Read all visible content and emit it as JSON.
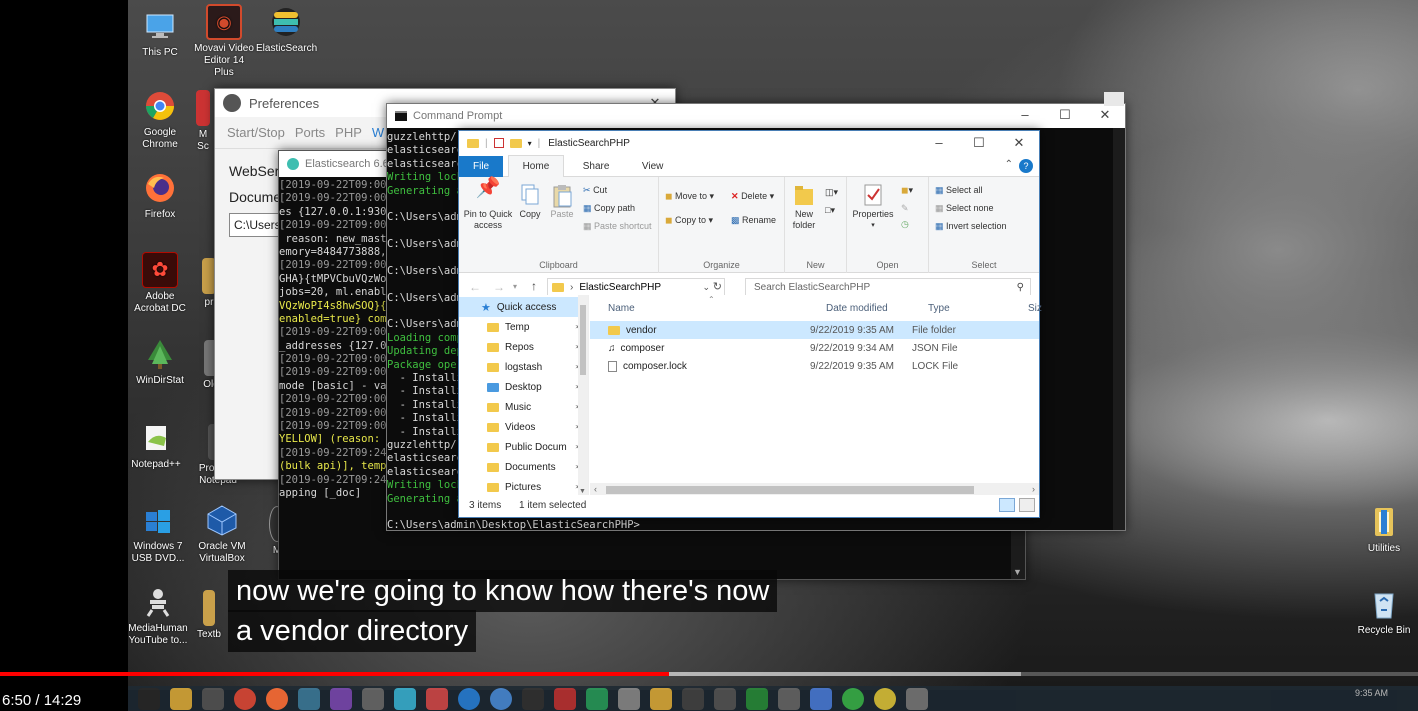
{
  "desktop_icons": [
    {
      "label": "This PC",
      "icon": "monitor-icon",
      "color": "#4aa3e8"
    },
    {
      "label": "Movavi Video Editor 14 Plus",
      "icon": "movavi-icon",
      "color": "#d24a2c"
    },
    {
      "label": "ElasticSearch",
      "icon": "elasticsearch-icon",
      "color": "#3ebeb0"
    },
    {
      "label": "Google Chrome",
      "icon": "chrome-icon",
      "color": "#dd4b39"
    },
    {
      "label": "Firefox",
      "icon": "firefox-icon",
      "color": "#ff7139"
    },
    {
      "label": "Adobe Acrobat DC",
      "icon": "acrobat-icon",
      "color": "#b30b00"
    },
    {
      "label": "WinDirStat",
      "icon": "windirstat-icon",
      "color": "#3a8a3a"
    },
    {
      "label": "Notepad++",
      "icon": "notepadpp-icon",
      "color": "#8bc34a"
    },
    {
      "label": "Windows 7 USB DVD...",
      "icon": "windows-usb-icon",
      "color": "#2a7fd4"
    },
    {
      "label": "Oracle VM VirtualBox",
      "icon": "virtualbox-icon",
      "color": "#1e5aa8"
    },
    {
      "label": "MediaHuman YouTube to...",
      "icon": "mediahuman-icon",
      "color": "#cccccc"
    },
    {
      "label": "Utilities",
      "icon": "utilities-icon",
      "color": "#e6c35a"
    },
    {
      "label": "Recycle Bin",
      "icon": "recycle-bin-icon",
      "color": "#9ec7e6"
    }
  ],
  "desktop_partial_labels": {
    "ms": "M",
    "sc": "Sc",
    "pr": "pr",
    "old": "Old",
    "program": "Program",
    "notepad": "Notepad",
    "textb": "Textb",
    "m": "M"
  },
  "preferences": {
    "title": "Preferences",
    "tabs": [
      "Start/Stop",
      "Ports",
      "PHP",
      "W"
    ],
    "label1": "WebServ",
    "label2": "Documen",
    "path_value": "C:\\Users\\a"
  },
  "elasticsearch_window": {
    "title": "Elasticsearch 6.6",
    "log": [
      {
        "t": "[2019-09-22T09:00",
        "c": "#9a9a9a"
      },
      {
        "t": "[2019-09-22T09:00",
        "c": "#9a9a9a"
      },
      {
        "t": "es {127.0.0.1:930",
        "c": "#d8d8d8"
      },
      {
        "t": "[2019-09-22T09:00",
        "c": "#9a9a9a"
      },
      {
        "t": " reason: new_mast",
        "c": "#d8d8d8"
      },
      {
        "t": "emory=8484773888,",
        "c": "#d8d8d8"
      },
      {
        "t": "[2019-09-22T09:00",
        "c": "#9a9a9a"
      },
      {
        "t": "GHA}{tMPVCbuVQzWo",
        "c": "#d8d8d8"
      },
      {
        "t": "jobs=20, ml.enabl",
        "c": "#d8d8d8"
      },
      {
        "t": "VQzWoPI4s8hwSOQ}{",
        "c": "#e8e84a"
      },
      {
        "t": "enabled=true} com",
        "c": "#e8e84a"
      },
      {
        "t": "[2019-09-22T09:00",
        "c": "#9a9a9a"
      },
      {
        "t": "_addresses {127.0",
        "c": "#d8d8d8"
      },
      {
        "t": "[2019-09-22T09:00",
        "c": "#9a9a9a"
      },
      {
        "t": "[2019-09-22T09:00",
        "c": "#9a9a9a"
      },
      {
        "t": "mode [basic] - va",
        "c": "#d8d8d8"
      },
      {
        "t": "[2019-09-22T09:00",
        "c": "#9a9a9a"
      },
      {
        "t": "[2019-09-22T09:00",
        "c": "#9a9a9a"
      },
      {
        "t": "[2019-09-22T09:00",
        "c": "#9a9a9a"
      },
      {
        "t": "YELLOW] (reason: ",
        "c": "#e8e84a"
      },
      {
        "t": "[2019-09-22T09:24",
        "c": "#9a9a9a"
      },
      {
        "t": "(bulk api)], temp",
        "c": "#e8e84a"
      },
      {
        "t": "[2019-09-22T09:24",
        "c": "#9a9a9a"
      },
      {
        "t": "apping [_doc]",
        "c": "#d8d8d8"
      }
    ]
  },
  "command_prompt": {
    "title": "Command Prompt",
    "lines": [
      {
        "t": "guzzlehttp/r",
        "c": "#d8d8d8"
      },
      {
        "t": "elasticsearc",
        "c": "#d8d8d8"
      },
      {
        "t": "elasticsearc",
        "c": "#d8d8d8"
      },
      {
        "t": "Writing lock",
        "c": "#3fbf3f"
      },
      {
        "t": "Generating a",
        "c": "#3fbf3f"
      },
      {
        "t": "",
        "c": "#d8d8d8"
      },
      {
        "t": "C:\\Users\\adm",
        "c": "#d8d8d8"
      },
      {
        "t": "",
        "c": "#d8d8d8"
      },
      {
        "t": "C:\\Users\\adm",
        "c": "#d8d8d8"
      },
      {
        "t": "",
        "c": "#d8d8d8"
      },
      {
        "t": "C:\\Users\\adm",
        "c": "#d8d8d8"
      },
      {
        "t": "",
        "c": "#d8d8d8"
      },
      {
        "t": "C:\\Users\\adm",
        "c": "#d8d8d8"
      },
      {
        "t": "",
        "c": "#d8d8d8"
      },
      {
        "t": "C:\\Users\\adm",
        "c": "#d8d8d8"
      },
      {
        "t": "Loading comp",
        "c": "#3fbf3f"
      },
      {
        "t": "Updating dep",
        "c": "#3fbf3f"
      },
      {
        "t": "Package oper",
        "c": "#3fbf3f"
      },
      {
        "t": "  - Installi",
        "c": "#d8d8d8"
      },
      {
        "t": "  - Installi",
        "c": "#d8d8d8"
      },
      {
        "t": "  - Installi",
        "c": "#d8d8d8"
      },
      {
        "t": "  - Installi",
        "c": "#d8d8d8"
      },
      {
        "t": "  - Installi",
        "c": "#d8d8d8"
      },
      {
        "t": "guzzlehttp/r",
        "c": "#d8d8d8"
      },
      {
        "t": "elasticsearc",
        "c": "#d8d8d8"
      },
      {
        "t": "elasticsearc",
        "c": "#d8d8d8"
      },
      {
        "t": "Writing lock",
        "c": "#3fbf3f"
      },
      {
        "t": "Generating a",
        "c": "#3fbf3f"
      },
      {
        "t": "",
        "c": "#d8d8d8"
      },
      {
        "t": "C:\\Users\\admin\\Desktop\\ElasticSearchPHP>",
        "c": "#d8d8d8"
      }
    ]
  },
  "explorer": {
    "title": "ElasticSearchPHP",
    "tabs": {
      "file": "File",
      "home": "Home",
      "share": "Share",
      "view": "View"
    },
    "ribbon": {
      "pin": "Pin to Quick access",
      "copy": "Copy",
      "paste": "Paste",
      "cut": "Cut",
      "copy_path": "Copy path",
      "paste_shortcut": "Paste shortcut",
      "clipboard": "Clipboard",
      "move_to": "Move to",
      "copy_to": "Copy to",
      "delete": "Delete",
      "rename": "Rename",
      "organize": "Organize",
      "new_folder": "New folder",
      "new": "New",
      "properties": "Properties",
      "open": "Open",
      "select_all": "Select all",
      "select_none": "Select none",
      "invert_selection": "Invert selection",
      "select": "Select"
    },
    "address": "ElasticSearchPHP",
    "search_placeholder": "Search ElasticSearchPHP",
    "nav": {
      "quick_access": "Quick access",
      "items": [
        "Temp",
        "Repos",
        "logstash",
        "Desktop",
        "Music",
        "Videos",
        "Public Docum",
        "Documents",
        "Pictures"
      ]
    },
    "columns": {
      "name": "Name",
      "date": "Date modified",
      "type": "Type",
      "size": "Siz"
    },
    "files": [
      {
        "name": "vendor",
        "date": "9/22/2019 9:35 AM",
        "type": "File folder"
      },
      {
        "name": "composer",
        "date": "9/22/2019 9:34 AM",
        "type": "JSON File"
      },
      {
        "name": "composer.lock",
        "date": "9/22/2019 9:35 AM",
        "type": "LOCK File"
      }
    ],
    "status": {
      "items": "3 items",
      "selected": "1 item selected"
    }
  },
  "subtitles": {
    "line1": "now we're going to know how there's now",
    "line2": "a vendor directory"
  },
  "player": {
    "time": "6:50 / 14:29",
    "progress": 0.472,
    "buffered": 0.72,
    "progress_color": "#ff0000"
  },
  "taskbar": {
    "clock": "9:35 AM"
  }
}
